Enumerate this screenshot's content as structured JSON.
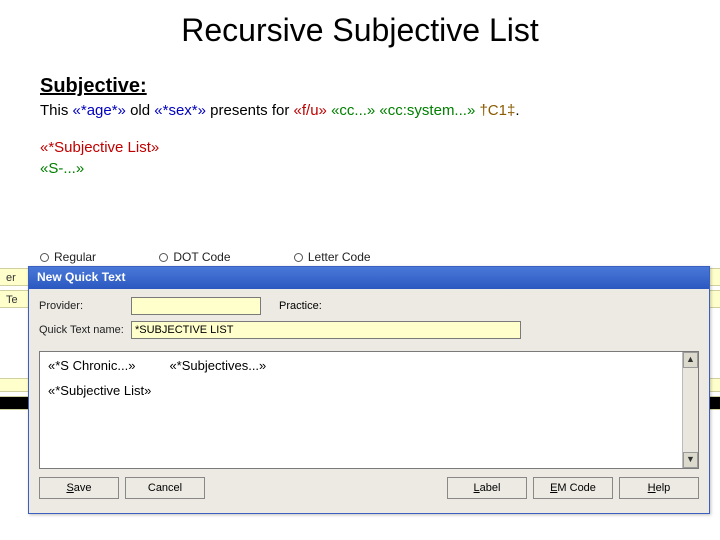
{
  "slide": {
    "title": "Recursive Subjective List"
  },
  "subjective": {
    "heading": "Subjective:",
    "line_prefix": "This ",
    "age_token": "«*age*»",
    "mid1": " old ",
    "sex_token": "«*sex*»",
    "mid2": " presents for ",
    "fu_token": "«f/u»",
    "sp1": " ",
    "cc_token": "«cc...»",
    "sp2": " ",
    "ccsys_token": "«cc:system...»",
    "sp3": " ",
    "c1_token": "†C1‡",
    "period": ".",
    "list_token": "«*Subjective List»",
    "s_token": "«S-...»"
  },
  "background": {
    "row1_label": "er",
    "row2_label": "Te",
    "radios": [
      "Regular",
      "DOT Code",
      "Letter Code"
    ]
  },
  "dialog": {
    "title": "New Quick Text",
    "provider_label": "Provider:",
    "provider_value": "",
    "practice_label": "Practice:",
    "qt_label": "Quick Text name:",
    "qt_value": "*SUBJECTIVE LIST",
    "editor": {
      "token_chronic": "«*S Chronic...»",
      "token_subjectives": "«*Subjectives...»",
      "token_list": "«*Subjective List»"
    },
    "buttons": {
      "save": "Save",
      "cancel": "Cancel",
      "label": "Label",
      "emcode": "EM Code",
      "help": "Help"
    }
  }
}
